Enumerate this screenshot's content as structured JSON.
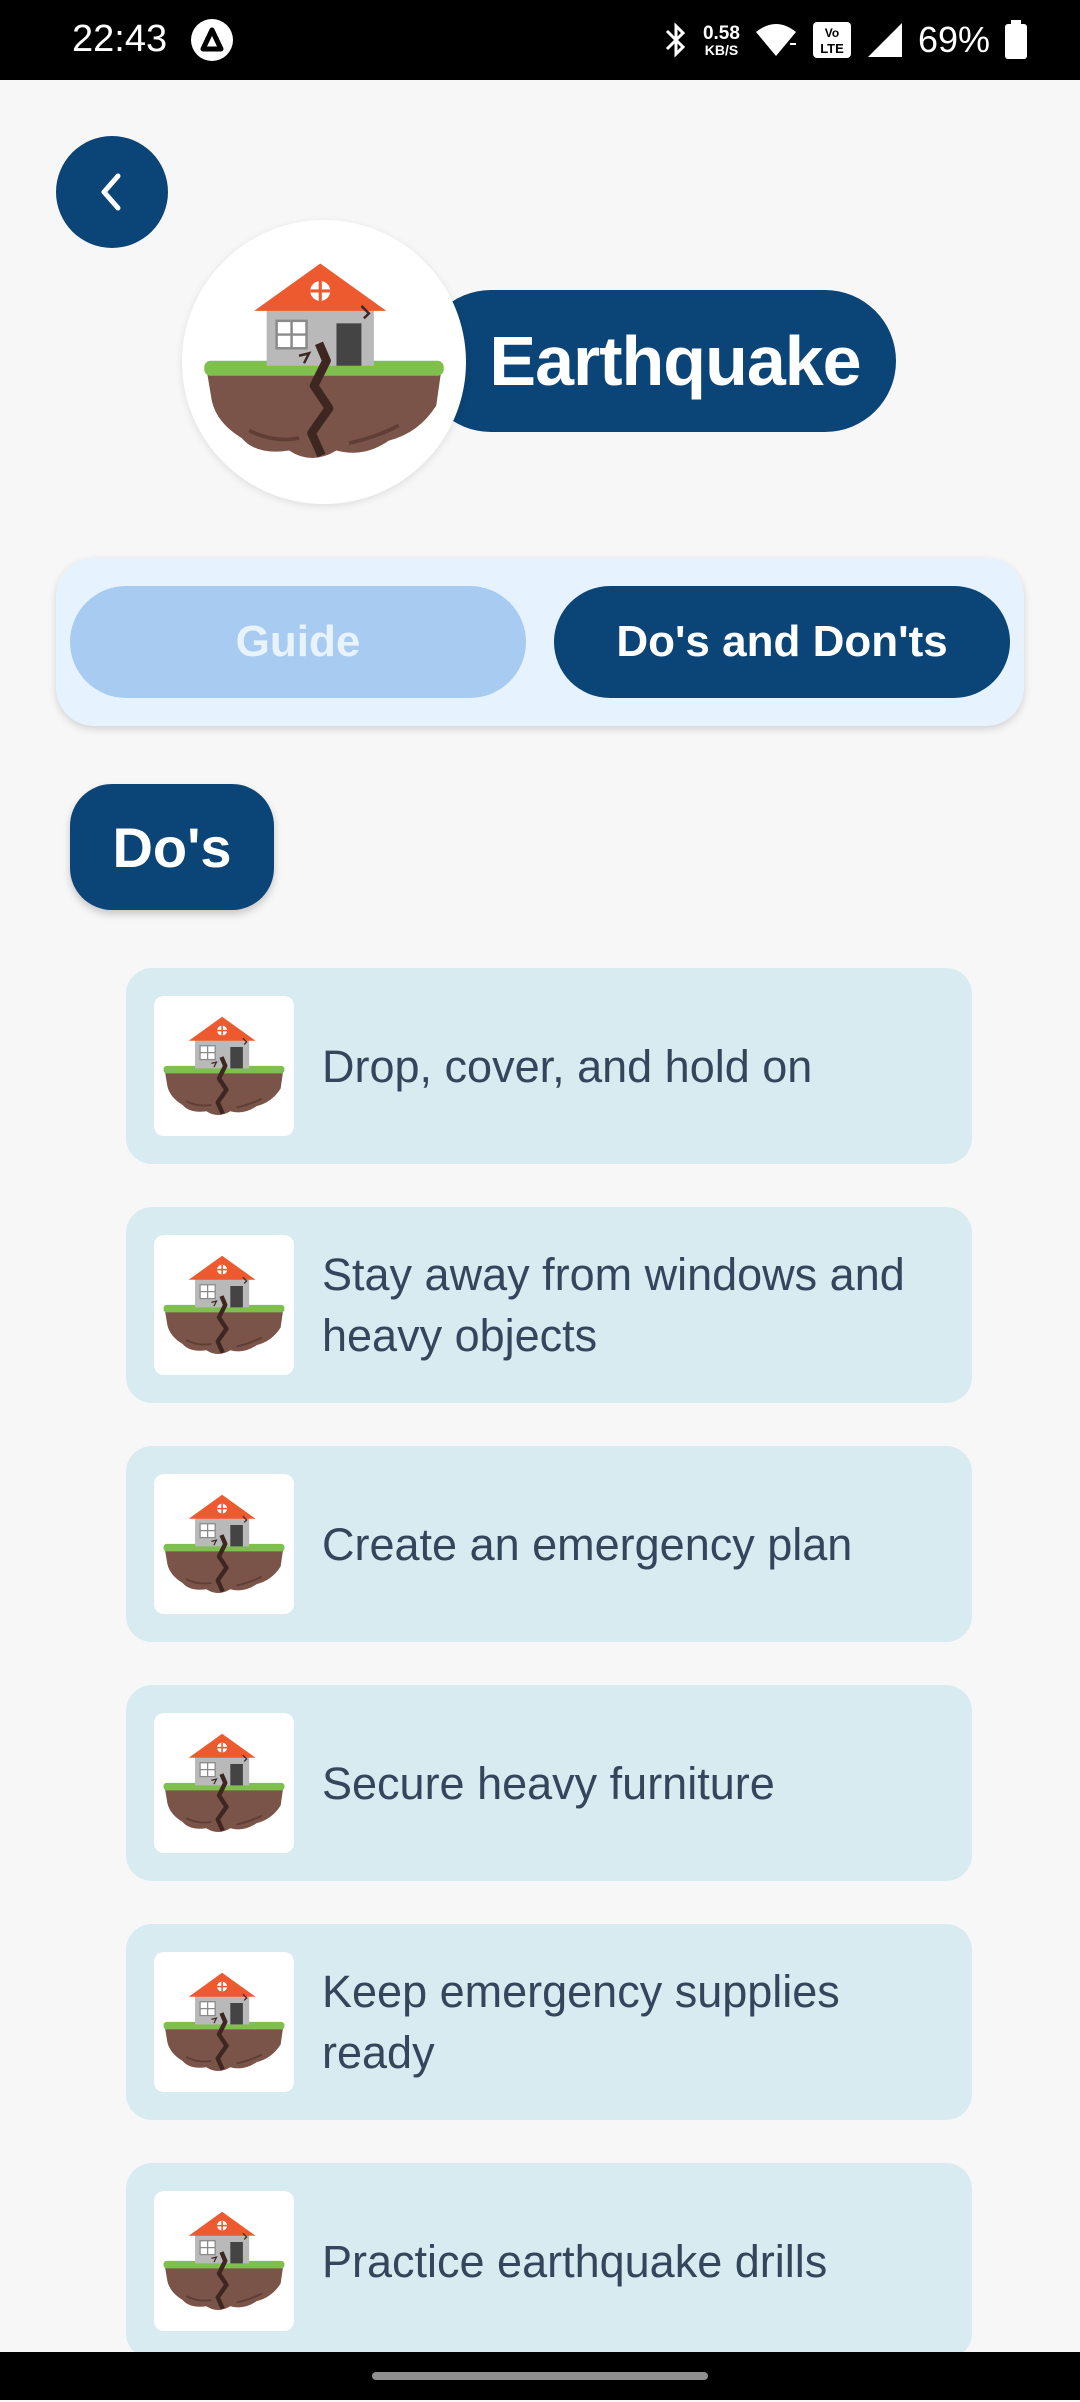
{
  "status_bar": {
    "time": "22:43",
    "speed_value": "0.58",
    "speed_unit": "KB/S",
    "battery_text": "69%",
    "icons": [
      "app-a-icon",
      "bluetooth-icon",
      "wifi-icon",
      "volte-icon",
      "cell-signal-icon",
      "battery-icon"
    ]
  },
  "header": {
    "title": "Earthquake",
    "back_icon": "chevron-left-icon",
    "hero_icon": "house-earthquake-icon"
  },
  "tabs": [
    {
      "label": "Guide",
      "selected": false
    },
    {
      "label": "Do's and Don'ts",
      "selected": true
    }
  ],
  "section": {
    "title": "Do's"
  },
  "items": [
    {
      "text": "Drop, cover, and hold on",
      "icon": "house-earthquake-icon"
    },
    {
      "text": "Stay away from windows and heavy objects",
      "icon": "house-earthquake-icon"
    },
    {
      "text": "Create an emergency plan",
      "icon": "house-earthquake-icon"
    },
    {
      "text": "Secure heavy furniture",
      "icon": "house-earthquake-icon"
    },
    {
      "text": "Keep emergency supplies ready",
      "icon": "house-earthquake-icon"
    },
    {
      "text": "Practice earthquake drills",
      "icon": "house-earthquake-icon"
    }
  ],
  "colors": {
    "primary": "#0b4477",
    "tab_inactive": "#a8cbf2",
    "tab_container": "#e6f2fd",
    "card": "#d8ebf0",
    "card_text": "#34465c",
    "background": "#f7f7f7"
  }
}
